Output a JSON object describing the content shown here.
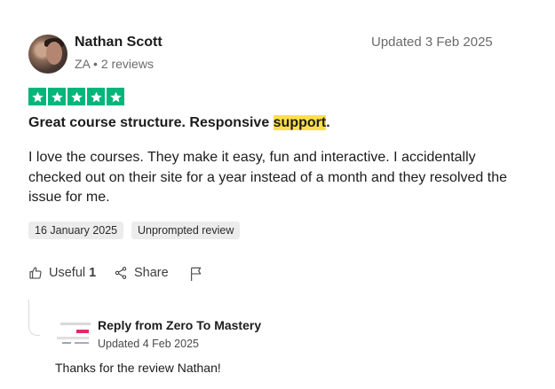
{
  "reviewer": {
    "name": "Nathan Scott",
    "country": "ZA",
    "separator": "•",
    "reviews": "2 reviews"
  },
  "updated": "Updated 3 Feb 2025",
  "rating": {
    "stars": 5,
    "of": 5,
    "color": "#00b67a"
  },
  "review": {
    "title_before": "Great course structure. Responsive ",
    "title_highlight": "support",
    "title_after": ".",
    "highlight_color": "#fde047",
    "body": "I love the courses. They make it easy, fun and interactive. I accidentally checked out on their site for a year instead of a month and they resolved the issue for me."
  },
  "tags": {
    "date": "16 January 2025",
    "type": "Unprompted review"
  },
  "actions": {
    "useful_label": "Useful",
    "useful_count": "1",
    "share_label": "Share"
  },
  "reply": {
    "title": "Reply from Zero To Mastery",
    "date": "Updated 4 Feb 2025",
    "text": "Thanks for the review Nathan!"
  }
}
